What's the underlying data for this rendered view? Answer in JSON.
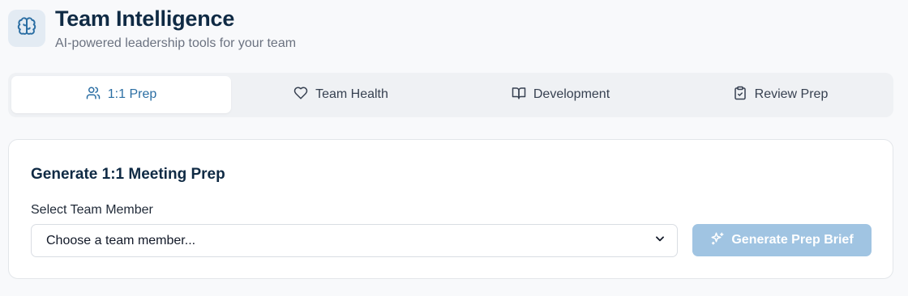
{
  "header": {
    "title": "Team Intelligence",
    "subtitle": "AI-powered leadership tools for your team",
    "logo_icon": "brain-icon"
  },
  "tabs": [
    {
      "label": "1:1 Prep",
      "icon": "users-icon",
      "active": true
    },
    {
      "label": "Team Health",
      "icon": "heart-icon",
      "active": false
    },
    {
      "label": "Development",
      "icon": "book-open-icon",
      "active": false
    },
    {
      "label": "Review Prep",
      "icon": "clipboard-check-icon",
      "active": false
    }
  ],
  "card": {
    "title": "Generate 1:1 Meeting Prep",
    "field_label": "Select Team Member",
    "select_value": "Choose a team member...",
    "button_label": "Generate Prep Brief",
    "button_icon": "sparkles-icon"
  },
  "colors": {
    "accent": "#2b6ea3",
    "title": "#0f2a44",
    "button_disabled": "#a0c4e2"
  }
}
